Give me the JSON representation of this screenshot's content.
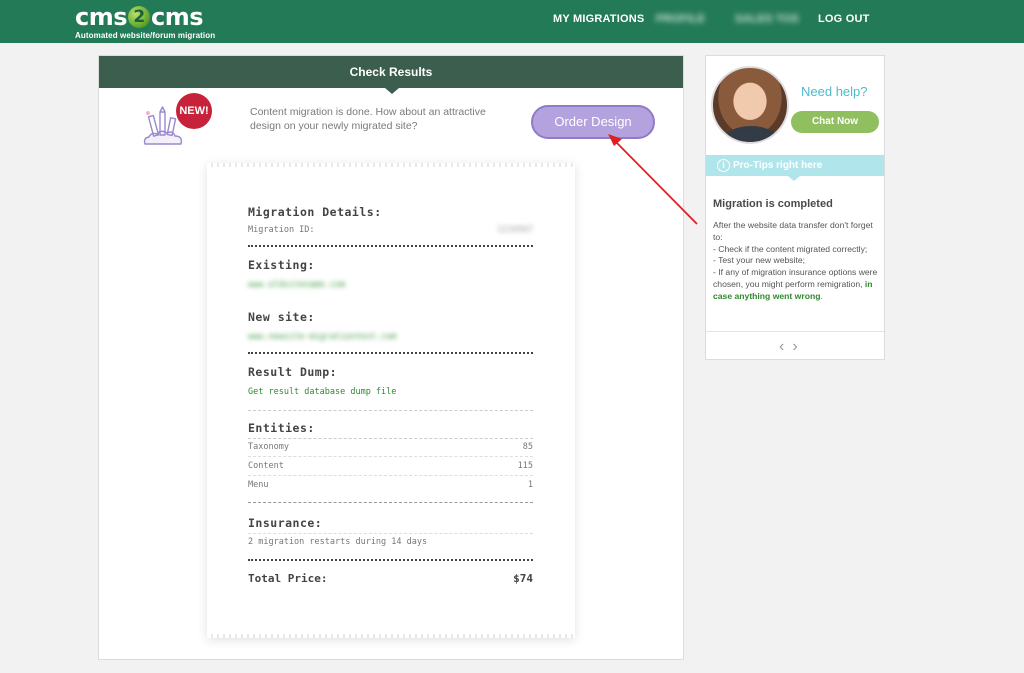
{
  "brand": {
    "logo_left": "cms",
    "logo_mid": "2",
    "logo_right": "cms",
    "tagline": "Automated website/forum migration"
  },
  "nav": {
    "my_migrations": "MY MIGRATIONS",
    "blurred_1": "PROFILE",
    "blurred_2": "SALES TOS",
    "logout": "LOG OUT"
  },
  "panel": {
    "title": "Check Results",
    "badge": "NEW!",
    "promo_text": "Content migration is done. How about an attractive design on your newly migrated site?",
    "order_button": "Order Design"
  },
  "receipt": {
    "details_title": "Migration Details:",
    "migration_id_label": "Migration ID:",
    "migration_id_value": "1234567",
    "existing_title": "Existing:",
    "existing_value": "www.oldsitename.com",
    "new_site_title": "New site:",
    "new_site_value": "www.newsite-migrationtest.com",
    "dump_title": "Result Dump:",
    "dump_link": "Get result database dump file",
    "entities_title": "Entities:",
    "entities": [
      {
        "label": "Taxonomy",
        "value": "85"
      },
      {
        "label": "Content",
        "value": "115"
      },
      {
        "label": "Menu",
        "value": "1"
      }
    ],
    "insurance_title": "Insurance:",
    "insurance_text": "2 migration restarts during 14 days",
    "total_label": "Total Price:",
    "total_value": "$74"
  },
  "help": {
    "need_help": "Need help?",
    "chat_button": "Chat Now",
    "tips_bar": "Pro-Tips right here",
    "tips_title": "Migration is completed",
    "tips_intro": "After the website data transfer don't forget to:",
    "tip_1": "- Check if the content migrated correctly;",
    "tip_2": "- Test your new website;",
    "tip_3": "- If any of migration insurance options were chosen, you might perform remigration,",
    "tip_3_emph": "in case anything went wrong",
    "tip_3_end": "."
  },
  "colors": {
    "topbar": "#237a57",
    "panel_header": "#3b5e4e",
    "order_button": "#b3a2de",
    "chat_button": "#8fbf5f",
    "tips_bar": "#b1e5ec",
    "badge": "#c8213a",
    "annotation_arrow": "#e02020"
  }
}
